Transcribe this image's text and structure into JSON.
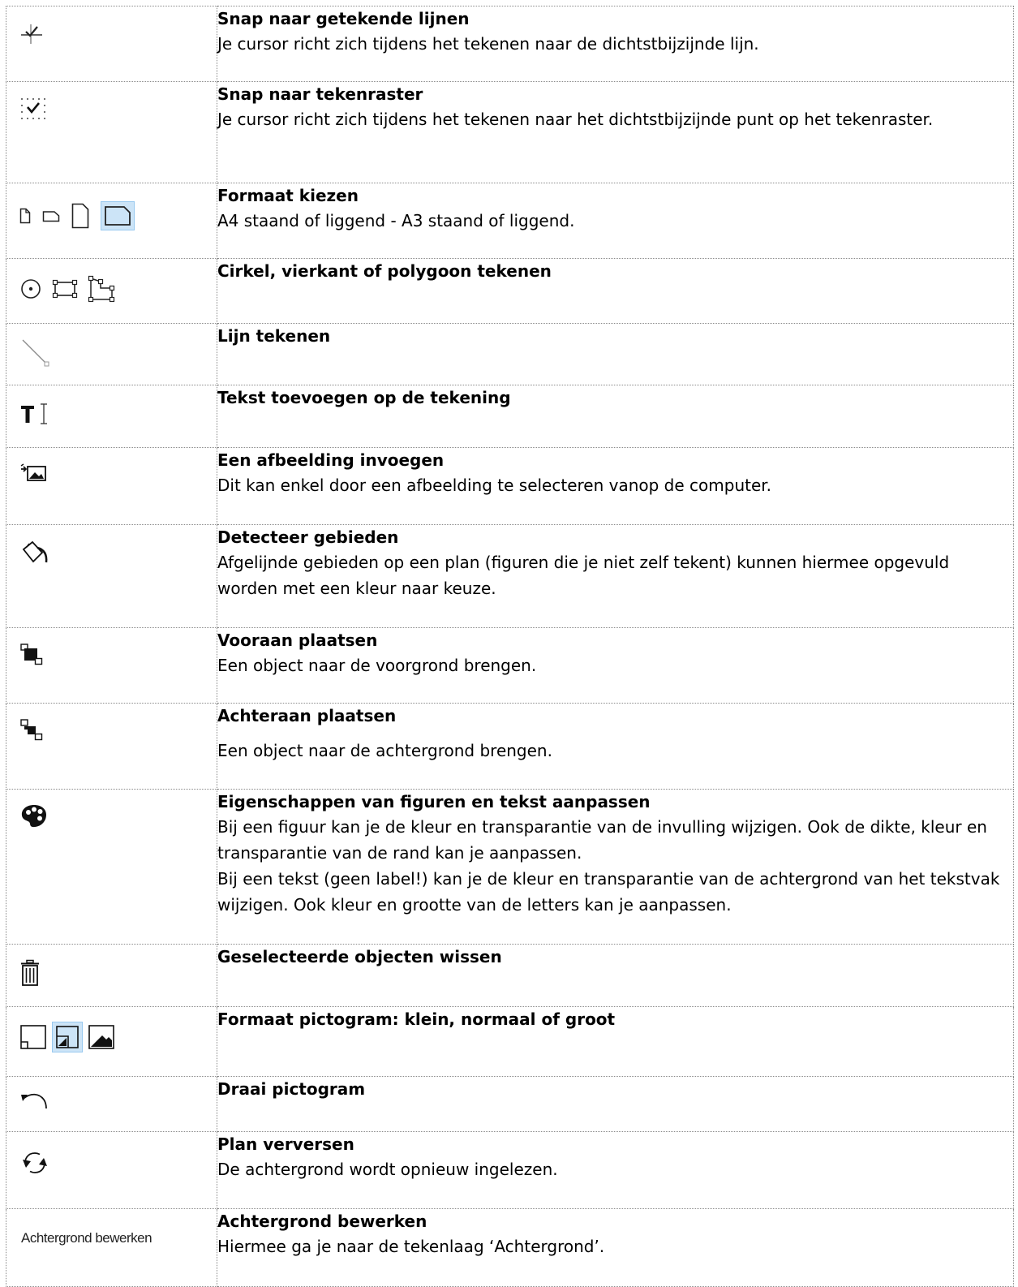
{
  "rows": [
    {
      "icon": "snap-lines-icon",
      "title": "Snap naar getekende lijnen",
      "desc": "Je cursor richt zich tijdens het tekenen naar de dichtstbijzijnde lijn."
    },
    {
      "icon": "snap-grid-icon",
      "title": "Snap naar tekenraster",
      "desc": "Je cursor richt zich tijdens het tekenen naar het dichtstbijzijnde punt op het tekenraster."
    },
    {
      "icon": "format-icons",
      "title": "Formaat kiezen",
      "desc": "A4 staand of liggend - A3 staand of liggend."
    },
    {
      "icon": "shape-icons",
      "title": "Cirkel, vierkant of polygoon tekenen",
      "desc": ""
    },
    {
      "icon": "line-icon",
      "title": "Lijn tekenen",
      "desc": ""
    },
    {
      "icon": "text-tool-icon",
      "title": "Tekst toevoegen op de tekening",
      "desc": ""
    },
    {
      "icon": "insert-image-icon",
      "title": "Een afbeelding invoegen",
      "desc": "Dit kan enkel door een afbeelding te selecteren vanop de computer."
    },
    {
      "icon": "paint-bucket-icon",
      "title": "Detecteer gebieden",
      "desc": "Afgelijnde gebieden op een plan (figuren die je niet zelf tekent) kunnen hiermee opgevuld worden met een kleur naar keuze."
    },
    {
      "icon": "bring-front-icon",
      "title": "Vooraan plaatsen",
      "desc": "Een object naar de voorgrond brengen."
    },
    {
      "icon": "send-back-icon",
      "title": "Achteraan plaatsen",
      "desc": "Een object naar de achtergrond brengen."
    },
    {
      "icon": "palette-icon",
      "title": "Eigenschappen van figuren en tekst aanpassen",
      "desc": "Bij een figuur kan je de kleur en transparantie van de invulling wijzigen. Ook de dikte, kleur en transparantie van de rand kan je aanpassen.",
      "desc2": "Bij een tekst (geen label!) kan je de kleur en transparantie van de achtergrond van het tekstvak wijzigen. Ook kleur en grootte van de letters kan je aanpassen."
    },
    {
      "icon": "trash-icon",
      "title": "Geselecteerde objecten wissen",
      "desc": ""
    },
    {
      "icon": "icon-size-icons",
      "title": "Formaat pictogram: klein, normaal of groot",
      "desc": ""
    },
    {
      "icon": "rotate-icon",
      "title": "Draai pictogram",
      "desc": ""
    },
    {
      "icon": "refresh-icon",
      "title": "Plan verversen",
      "desc": "De achtergrond wordt opnieuw ingelezen."
    },
    {
      "icon": "edit-background-button",
      "title": "Achtergrond bewerken",
      "desc": "Hiermee ga je naar de tekenlaag ‘Achtergrond’.",
      "button_label": "Achtergrond bewerken"
    }
  ]
}
